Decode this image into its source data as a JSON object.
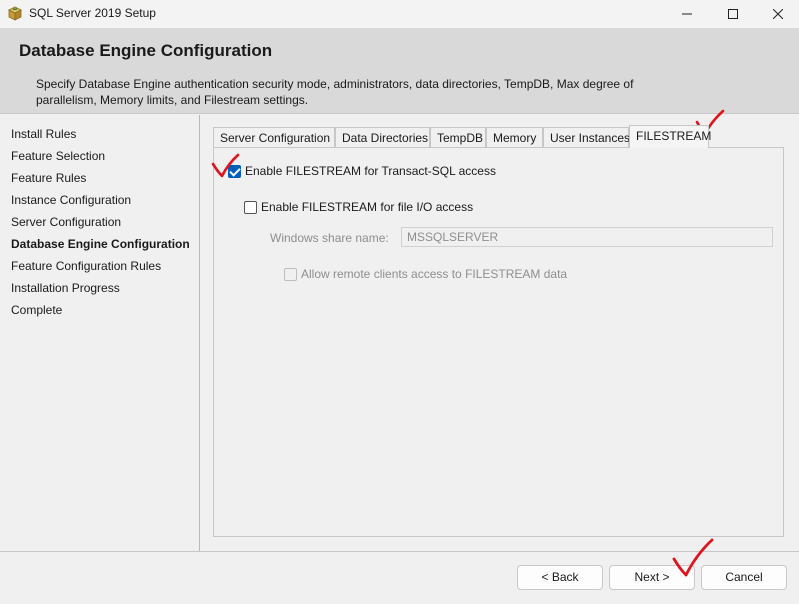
{
  "window": {
    "title": "SQL Server 2019 Setup",
    "icon": "sql-setup-box-icon",
    "minimize_icon": "minimize-icon",
    "maximize_icon": "maximize-icon",
    "close_icon": "close-icon"
  },
  "header": {
    "title": "Database Engine Configuration",
    "description": "Specify Database Engine authentication security mode, administrators, data directories, TempDB, Max degree of parallelism, Memory limits, and Filestream settings."
  },
  "sidebar": {
    "items": [
      {
        "label": "Install Rules",
        "active": false
      },
      {
        "label": "Feature Selection",
        "active": false
      },
      {
        "label": "Feature Rules",
        "active": false
      },
      {
        "label": "Instance Configuration",
        "active": false
      },
      {
        "label": "Server Configuration",
        "active": false
      },
      {
        "label": "Database Engine Configuration",
        "active": true
      },
      {
        "label": "Feature Configuration Rules",
        "active": false
      },
      {
        "label": "Installation Progress",
        "active": false
      },
      {
        "label": "Complete",
        "active": false
      }
    ]
  },
  "tabs": [
    {
      "label": "Server Configuration",
      "active": false
    },
    {
      "label": "Data Directories",
      "active": false
    },
    {
      "label": "TempDB",
      "active": false
    },
    {
      "label": "Memory",
      "active": false
    },
    {
      "label": "User Instances",
      "active": false
    },
    {
      "label": "FILESTREAM",
      "active": true
    }
  ],
  "filestream": {
    "tsql_label": "Enable FILESTREAM for Transact-SQL access",
    "tsql_checked": true,
    "fileio_label": "Enable FILESTREAM for file I/O access",
    "fileio_checked": false,
    "share_name_label": "Windows share name:",
    "share_name_value": "MSSQLSERVER",
    "remote_label": "Allow remote clients access to FILESTREAM data",
    "remote_checked": false
  },
  "buttons": {
    "back": "< Back",
    "next": "Next >",
    "cancel": "Cancel"
  },
  "colors": {
    "accent": "#005fb8",
    "annotation": "#e0141e",
    "header_bg": "#d9d9d9"
  }
}
